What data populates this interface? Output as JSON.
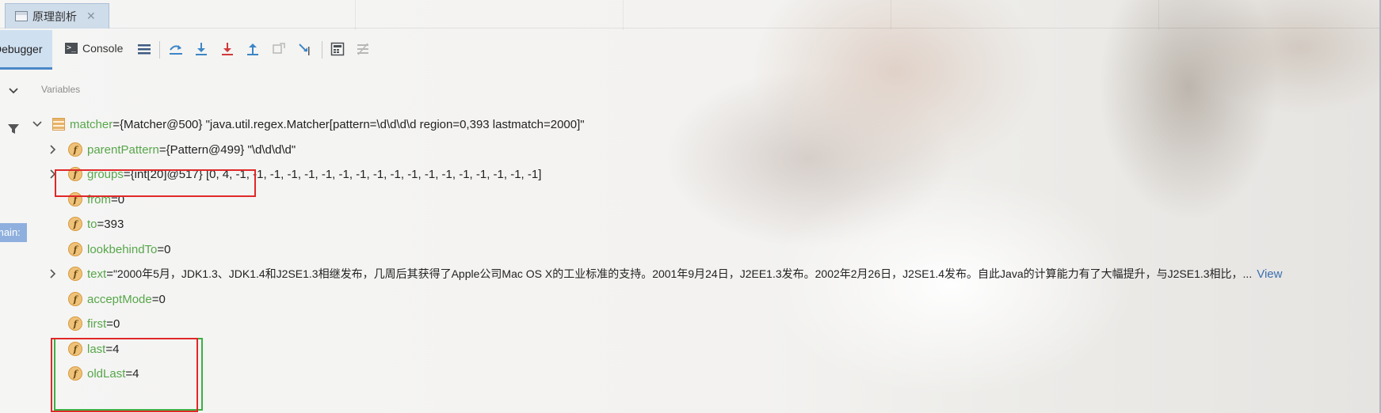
{
  "tab": {
    "title": "原理剖析",
    "close": "✕"
  },
  "toolbar": {
    "debugger_label": "Debugger",
    "console_label": "Console",
    "console_icon_glyph": ">_"
  },
  "frame_label": "main:",
  "variables_header": "Variables",
  "tree": {
    "root": {
      "name": "matcher",
      "eq": " = ",
      "value": "{Matcher@500} \"java.util.regex.Matcher[pattern=\\d\\d\\d\\d region=0,393 lastmatch=2000]\""
    },
    "fields": [
      {
        "name": "parentPattern",
        "eq": " = ",
        "value": "{Pattern@499} \"\\d\\d\\d\\d\"",
        "expandable": true
      },
      {
        "name": "groups",
        "eq": " = ",
        "value": "{int[20]@517} [0, 4, -1, -1, -1, -1, -1, -1, -1, -1, -1, -1, -1, -1, -1, -1, -1, -1, -1, -1]",
        "expandable": true
      },
      {
        "name": "from",
        "eq": " = ",
        "value": "0",
        "expandable": false
      },
      {
        "name": "to",
        "eq": " = ",
        "value": "393",
        "expandable": false
      },
      {
        "name": "lookbehindTo",
        "eq": " = ",
        "value": "0",
        "expandable": false
      },
      {
        "name": "text",
        "eq": " = ",
        "value": "\"2000年5月，JDK1.3、JDK1.4和J2SE1.3相继发布，几周后其获得了Apple公司Mac OS X的工业标准的支持。2001年9月24日，J2EE1.3发布。2002年2月26日，J2SE1.4发布。自此Java的计算能力有了大幅提升，与J2SE1.3相比，...",
        "link": "View",
        "expandable": true
      },
      {
        "name": "acceptMode",
        "eq": " = ",
        "value": "0",
        "expandable": false
      },
      {
        "name": "first",
        "eq": " = ",
        "value": "0",
        "expandable": false
      },
      {
        "name": "last",
        "eq": " = ",
        "value": "4",
        "expandable": false
      },
      {
        "name": "oldLast",
        "eq": " = ",
        "value": "4",
        "expandable": false
      }
    ]
  },
  "icons": {
    "tab": "debug-tab-icon",
    "console": "console-icon",
    "settings": "layout-settings-icon",
    "show_execution_point": "show-execution-point-icon",
    "step_over": "step-over-icon",
    "step_into": "step-into-icon",
    "force_step_into": "force-step-into-icon",
    "step_out": "step-out-icon",
    "drop_frame": "drop-frame-icon",
    "run_to_cursor": "run-to-cursor-icon",
    "evaluate": "evaluate-expression-icon",
    "trace": "trace-icon",
    "field": "f",
    "collapse": "chevron-down-icon",
    "filter": "filter-icon"
  },
  "colors": {
    "field_name": "#57a64a",
    "highlight_red": "#e02828",
    "highlight_green": "#3cb043",
    "tab_active": "#cfe0f1",
    "link": "#3a6fb0"
  }
}
